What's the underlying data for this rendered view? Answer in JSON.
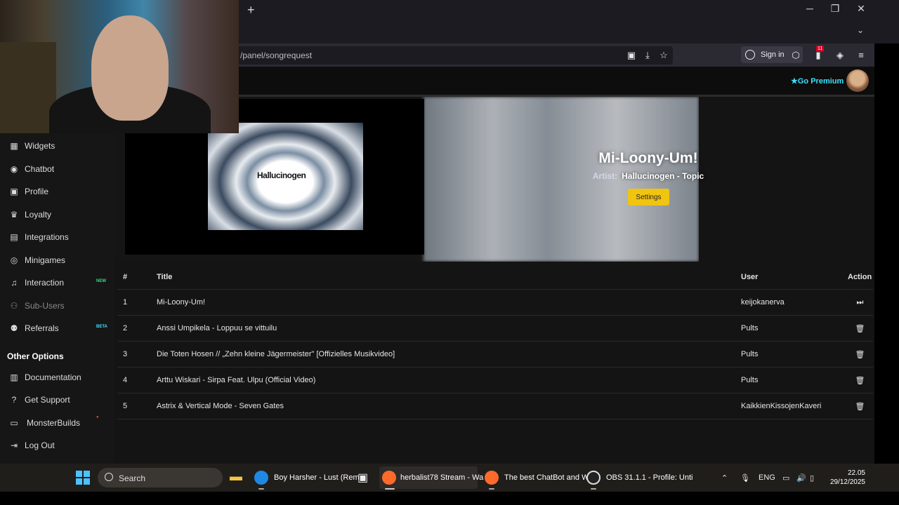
{
  "browser": {
    "new_tab": "+",
    "window_controls": {
      "minimize": "─",
      "restore": "❐",
      "close": "✕"
    },
    "tab_list": "⌄",
    "url": "/panel/songrequest",
    "sign_in": "Sign in",
    "badge_count": "11"
  },
  "site": {
    "premium_label": "Go Premium",
    "premium_icon": "★"
  },
  "sidebar": {
    "items": [
      {
        "label": "Widgets",
        "icon": "grid-icon",
        "glyph": "▦"
      },
      {
        "label": "Chatbot",
        "icon": "robot-icon",
        "glyph": "◉"
      },
      {
        "label": "Profile",
        "icon": "id-card-icon",
        "glyph": "▣"
      },
      {
        "label": "Loyalty",
        "icon": "trophy-icon",
        "glyph": "♛"
      },
      {
        "label": "Integrations",
        "icon": "puzzle-icon",
        "glyph": "▤"
      },
      {
        "label": "Minigames",
        "icon": "gamepad-icon",
        "glyph": "◎"
      },
      {
        "label": "Interaction",
        "icon": "music-icon",
        "glyph": "♫",
        "tag": "NEW"
      },
      {
        "label": "Sub-Users",
        "icon": "users-icon",
        "glyph": "⚇"
      },
      {
        "label": "Referrals",
        "icon": "people-icon",
        "glyph": "⚉",
        "tag": "BETA"
      }
    ],
    "other_heading": "Other Options",
    "other_items": [
      {
        "label": "Documentation",
        "icon": "book-icon",
        "glyph": "▥"
      },
      {
        "label": "Get Support",
        "icon": "question-icon",
        "glyph": "?"
      },
      {
        "label": "MonsterBuilds",
        "icon": "laptop-icon",
        "glyph": "▭"
      },
      {
        "label": "Log Out",
        "icon": "logout-icon",
        "glyph": "⇥"
      }
    ]
  },
  "now_playing": {
    "title": "Mi-Loony-Um!",
    "artist_label": "Artist:",
    "artist": "Hallucinogen - Topic",
    "settings_label": "Settings",
    "album_text": "Hallucinogen"
  },
  "queue": {
    "headers": {
      "num": "#",
      "title": "Title",
      "user": "User",
      "action": "Action"
    },
    "rows": [
      {
        "num": "1",
        "title": "Mi-Loony-Um!",
        "user": "keijokanerva",
        "action": "skip-icon",
        "glyph": "⏭"
      },
      {
        "num": "2",
        "title": "Anssi Umpikela - Loppuu se vittuilu",
        "user": "Pults",
        "action": "trash-icon",
        "glyph": "🗑"
      },
      {
        "num": "3",
        "title": "Die Toten Hosen // „Zehn kleine Jägermeister\" [Offizielles Musikvideo]",
        "user": "Pults",
        "action": "trash-icon",
        "glyph": "🗑"
      },
      {
        "num": "4",
        "title": "Arttu Wiskari - Sirpa Feat. Ulpu (Official Video)",
        "user": "Pults",
        "action": "trash-icon",
        "glyph": "🗑"
      },
      {
        "num": "5",
        "title": "Astrix & Vertical Mode - Seven Gates",
        "user": "KaikkienKissojenKaveri",
        "action": "trash-icon",
        "glyph": "🗑"
      }
    ]
  },
  "taskbar": {
    "search_label": "Search",
    "apps": [
      {
        "label": "Boy Harsher - Lust (Rem",
        "color": "#1f88e5"
      },
      {
        "label": "herbalist78 Stream - Wa",
        "color": "#ff6a2b"
      },
      {
        "label": "The best ChatBot and W",
        "color": "#ff6a2b"
      },
      {
        "label": "OBS 31.1.1 - Profile: Unti",
        "color": "#dddddd"
      }
    ],
    "lang": "ENG",
    "time": "22.05",
    "date": "29/12/2025"
  },
  "colors": {
    "accent_cyan": "#3ee2ff",
    "settings_yellow": "#f1c40f",
    "tag_new": "#3ddc84",
    "tag_beta": "#3ee2ff",
    "tag_red": "#e74c3c"
  }
}
